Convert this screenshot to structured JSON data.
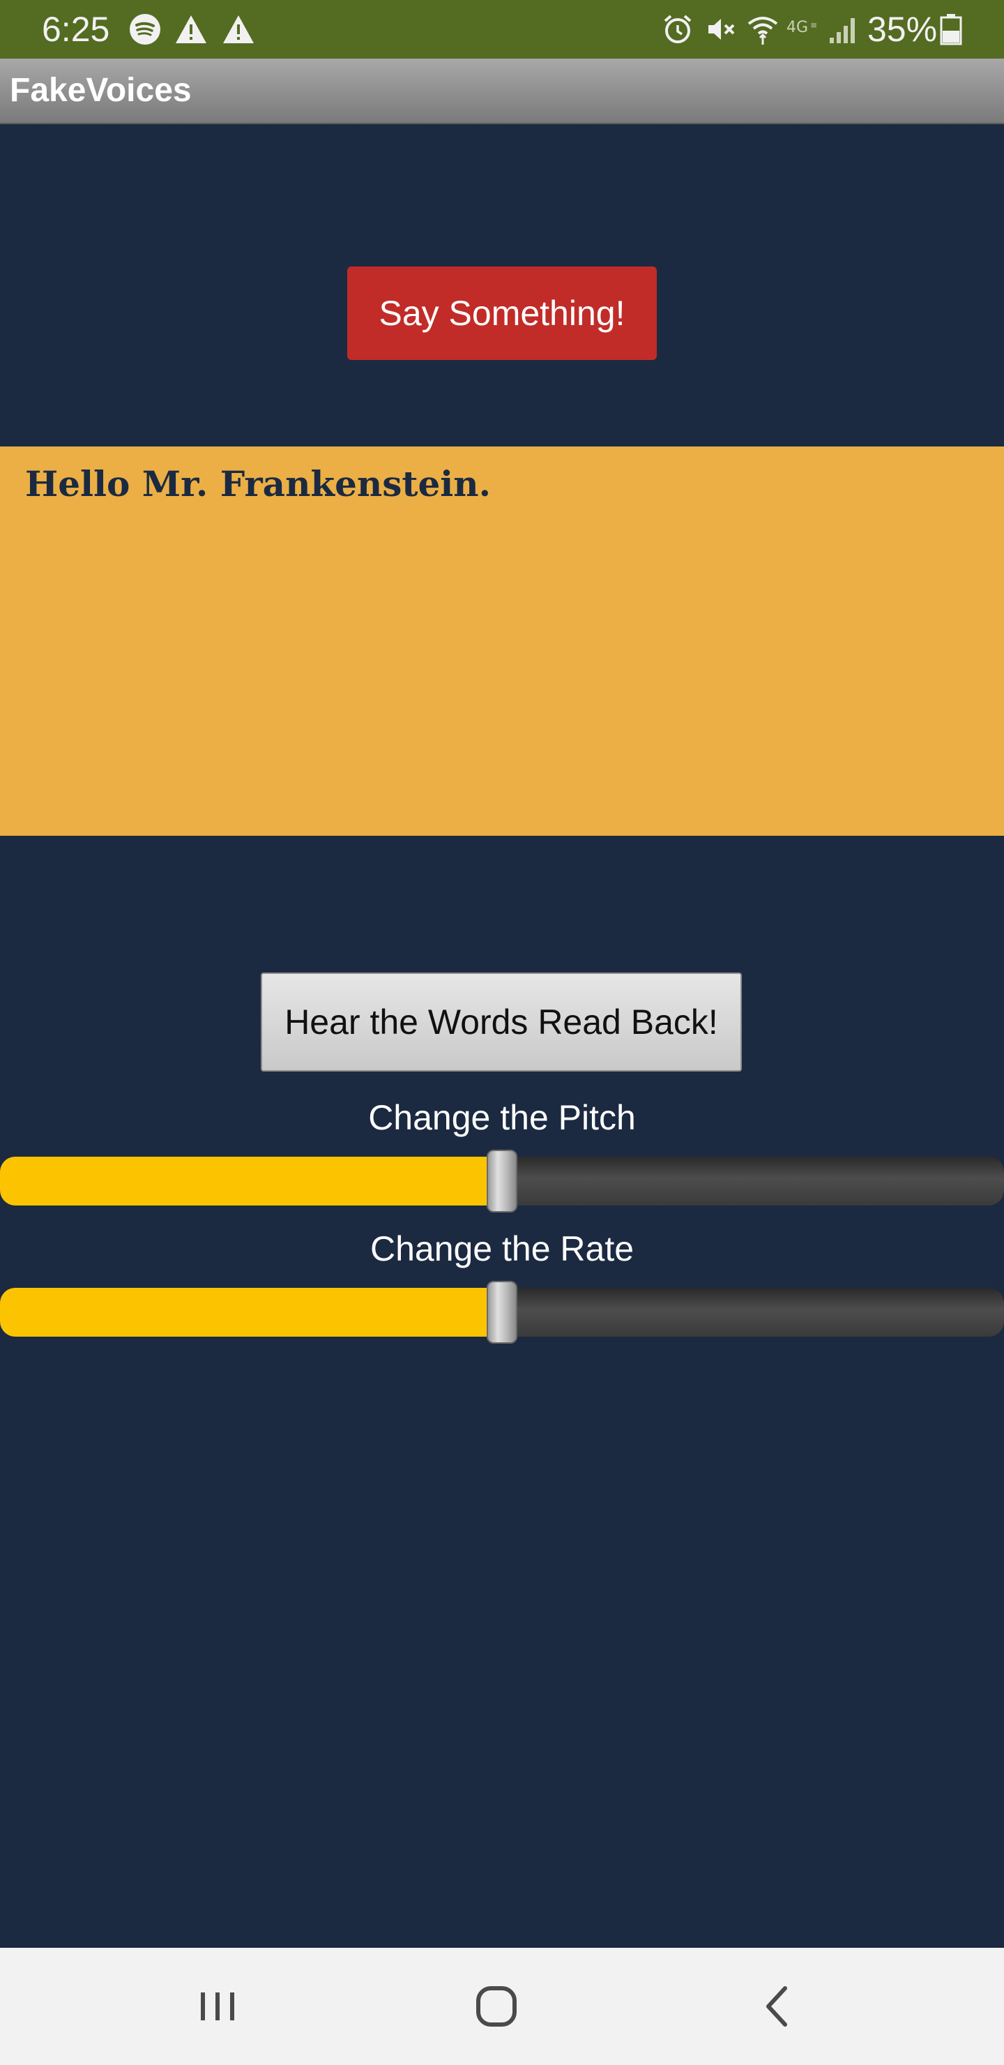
{
  "status_bar": {
    "time": "6:25",
    "battery_percent": "35%",
    "left_icons": [
      "spotify-icon",
      "warning-icon",
      "warning-icon"
    ],
    "right_icons": [
      "alarm-icon",
      "mute-icon",
      "wifi-calling-icon",
      "4g-icon",
      "signal-icon",
      "battery-icon"
    ],
    "color": "#546b22"
  },
  "app": {
    "title": "FakeVoices"
  },
  "main": {
    "say_button_label": "Say Something!",
    "speech_text": "Hello Mr. Frankenstein.",
    "readback_button_label": "Hear the Words Read Back!",
    "pitch_label": "Change the Pitch",
    "rate_label": "Change the Rate",
    "pitch_value": 0.5,
    "rate_value": 0.5
  },
  "colors": {
    "background": "#1b2a41",
    "say_button": "#c12c28",
    "speech_box": "#ebaf45",
    "slider_fill": "#fcc400"
  },
  "nav_bar": {
    "buttons": [
      "recents-icon",
      "home-icon",
      "back-icon"
    ]
  }
}
